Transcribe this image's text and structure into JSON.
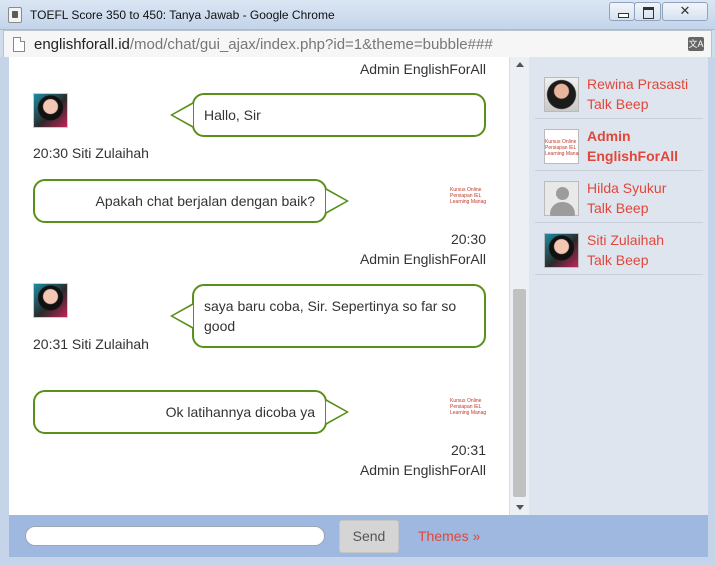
{
  "window": {
    "title": "TOEFL Score 350 to 450: Tanya Jawab - Google Chrome",
    "close_glyph": "✕"
  },
  "address": {
    "host": "englishforall.id",
    "path": "/mod/chat/gui_ajax/index.php?id=1&theme=bubble###",
    "translate_glyph": "文A"
  },
  "messages": [
    {
      "author": "Admin EnglishForAll",
      "direction": "out",
      "text": "",
      "time": "",
      "meta_only": true
    },
    {
      "author": "Siti Zulaihah",
      "direction": "in",
      "text": "Hallo, Sir",
      "time": "20:30",
      "meta": "20:30 Siti Zulaihah"
    },
    {
      "author": "Admin EnglishForAll",
      "direction": "out",
      "text": "Apakah chat berjalan dengan baik?",
      "time": "20:30"
    },
    {
      "author": "Siti Zulaihah",
      "direction": "in",
      "text": "saya baru coba, Sir. Sepertinya so far so good",
      "time": "20:31",
      "meta": "20:31 Siti Zulaihah"
    },
    {
      "author": "Admin EnglishForAll",
      "direction": "out",
      "text": "Ok latihannya dicoba ya",
      "time": "20:31"
    }
  ],
  "logo": {
    "line1": "Kursus Online",
    "line2": "Persiapan IEL",
    "line3": "Learning Managem"
  },
  "users": [
    {
      "name": "Rewina Prasasti",
      "action": "Talk Beep",
      "bold": false
    },
    {
      "name": "Admin",
      "name2": "EnglishForAll",
      "bold": true
    },
    {
      "name": "Hilda Syukur",
      "action": "Talk Beep",
      "bold": false
    },
    {
      "name": "Siti Zulaihah",
      "action": "Talk Beep",
      "bold": false
    }
  ],
  "footer": {
    "input_value": "",
    "send_label": "Send",
    "themes_label": "Themes »"
  },
  "colors": {
    "bubble_border": "#58901a",
    "link": "#e0473a",
    "footer_bg": "#9eb8df"
  }
}
